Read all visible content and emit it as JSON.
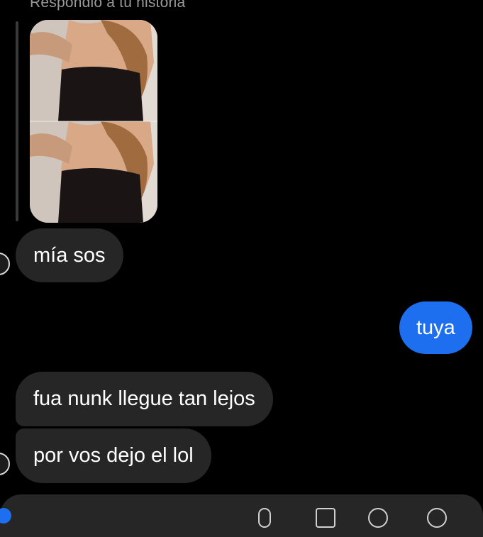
{
  "story_reply": {
    "label": "Respondió a tu historia"
  },
  "messages": [
    {
      "direction": "incoming",
      "text": "mía sos"
    },
    {
      "direction": "outgoing",
      "text": "tuya"
    },
    {
      "direction": "incoming",
      "text": "fua nunk llegue tan lejos"
    },
    {
      "direction": "incoming",
      "text": "por vos dejo el lol"
    }
  ],
  "colors": {
    "background": "#000000",
    "incoming_bubble": "#262626",
    "outgoing_bubble": "#1e6ff0",
    "meta_text": "#9a9a9a"
  },
  "composer": {
    "icons": [
      "send-accent-icon",
      "microphone-icon",
      "gallery-icon",
      "sticker-icon",
      "plus-icon"
    ]
  }
}
